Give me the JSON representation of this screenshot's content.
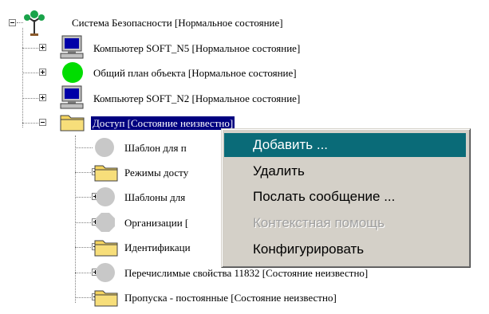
{
  "tree": {
    "root_label": "Система Безопасности [Нормальное состояние]",
    "items": [
      {
        "label": "Компьютер SOFT_N5 [Нормальное состояние]",
        "icon": "computer-icon"
      },
      {
        "label": "Общий план объекта [Нормальное состояние]",
        "icon": "green-circle-icon"
      },
      {
        "label": "Компьютер SOFT_N2 [Нормальное состояние]",
        "icon": "computer-icon"
      },
      {
        "label": "Доступ [Состояние неизвестно]",
        "icon": "folder-icon",
        "selected": true
      }
    ],
    "children": [
      {
        "label": "Шаблон для п",
        "icon": "gray-circle-icon"
      },
      {
        "label": "Режимы досту",
        "icon": "folder-icon"
      },
      {
        "label": "Шаблоны для",
        "icon": "gray-circle-icon"
      },
      {
        "label": "Организации [",
        "icon": "gray-octagon-icon"
      },
      {
        "label": "Идентификаци",
        "icon": "folder-icon"
      },
      {
        "label": "Перечислимые свойства 11832 [Состояние неизвестно]",
        "icon": "gray-circle-icon"
      },
      {
        "label": "Пропуска - постоянные [Состояние неизвестно]",
        "icon": "folder-icon"
      }
    ]
  },
  "context_menu": {
    "items": [
      {
        "label": "Добавить ...",
        "state": "highlighted"
      },
      {
        "label": "Удалить",
        "state": "enabled"
      },
      {
        "label": "Послать сообщение ...",
        "state": "enabled"
      },
      {
        "label": "Контекстная помощь",
        "state": "disabled"
      },
      {
        "label": "Конфигурировать",
        "state": "enabled"
      }
    ]
  },
  "colors": {
    "selection": "#000080",
    "menu_highlight": "#0a6b78",
    "menu_background": "#d4d0c8",
    "folder": "#f4d35e",
    "status_ok": "#00cc00",
    "unknown_gray": "#c0c0c0"
  }
}
